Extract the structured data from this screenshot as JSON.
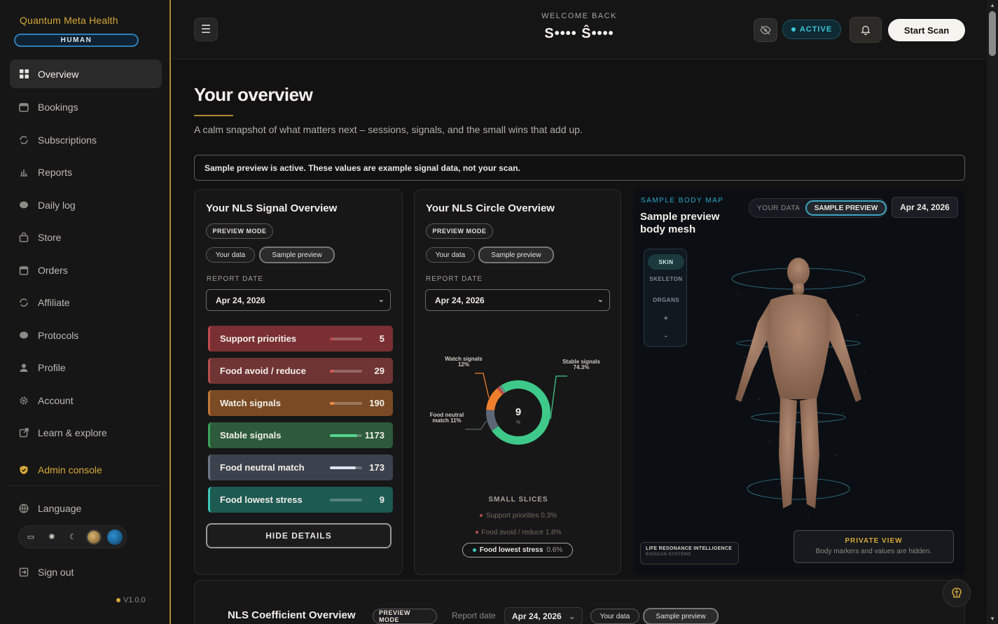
{
  "sidebar": {
    "brand": "Quantum Meta Health",
    "mode_badge": "HUMAN",
    "items": [
      {
        "label": "Overview",
        "icon": "grid-icon"
      },
      {
        "label": "Bookings",
        "icon": "calendar-icon"
      },
      {
        "label": "Subscriptions",
        "icon": "refresh-icon"
      },
      {
        "label": "Reports",
        "icon": "chart-icon"
      },
      {
        "label": "Daily log",
        "icon": "bubble-icon"
      },
      {
        "label": "Store",
        "icon": "bag-icon"
      },
      {
        "label": "Orders",
        "icon": "box-icon"
      },
      {
        "label": "Affiliate",
        "icon": "link-icon"
      },
      {
        "label": "Protocols",
        "icon": "bubble-icon"
      },
      {
        "label": "Profile",
        "icon": "person-icon"
      },
      {
        "label": "Account",
        "icon": "gear-icon"
      },
      {
        "label": "Learn & explore",
        "icon": "external-icon"
      }
    ],
    "admin": "Admin console",
    "language": "Language",
    "sign_out": "Sign out",
    "version": "V1.0.0"
  },
  "topbar": {
    "welcome": "WELCOME BACK",
    "user": "S•••• Ŝ••••",
    "status": "ACTIVE",
    "start_scan": "Start Scan"
  },
  "overview": {
    "title": "Your overview",
    "subtitle": "A calm snapshot of what matters next – sessions, signals, and the small wins that add up.",
    "notice": "Sample preview is active. These values are example signal data, not your scan."
  },
  "signal_card": {
    "title": "Your NLS Signal Overview",
    "mode": "PREVIEW MODE",
    "your_data": "Your data",
    "sample_preview": "Sample preview",
    "report_date_label": "REPORT DATE",
    "report_date": "Apr 24, 2026",
    "rows": [
      {
        "label": "Support priorities",
        "value": "5",
        "level": 0.02,
        "bg": "#7a2f33",
        "edge": "#c24a4f",
        "fill": "#c24a4f"
      },
      {
        "label": "Food avoid / reduce",
        "value": "29",
        "level": 0.08,
        "bg": "#6f3434",
        "edge": "#b8504d",
        "fill": "#e45a4f"
      },
      {
        "label": "Watch signals",
        "value": "190",
        "level": 0.12,
        "bg": "#7a4a25",
        "edge": "#c2793a",
        "fill": "#f08a3e"
      },
      {
        "label": "Stable signals",
        "value": "1173",
        "level": 0.85,
        "bg": "#2c5a3b",
        "edge": "#3ea15d",
        "fill": "#57d38c"
      },
      {
        "label": "Food neutral match",
        "value": "173",
        "level": 0.8,
        "bg": "#3c424d",
        "edge": "#6b7787",
        "fill": "#dfe6ef"
      },
      {
        "label": "Food lowest stress",
        "value": "9",
        "level": 0.0,
        "bg": "#1d5a52",
        "edge": "#3cc6b6",
        "fill": "#3cc6b6"
      }
    ],
    "hide_details": "HIDE DETAILS"
  },
  "circle_card": {
    "title": "Your NLS Circle Overview",
    "mode": "PREVIEW MODE",
    "your_data": "Your data",
    "sample_preview": "Sample preview",
    "report_date_label": "REPORT DATE",
    "report_date": "Apr 24, 2026",
    "small_slices_title": "SMALL SLICES",
    "small_slices": [
      {
        "label": "Support priorities",
        "pct": "0.3%",
        "color": "#b3484c"
      },
      {
        "label": "Food avoid / reduce",
        "pct": "1.8%",
        "color": "#b8504d"
      }
    ],
    "highlight_slice": {
      "label": "Food lowest stress",
      "pct": "0.6%"
    }
  },
  "chart_data": {
    "type": "pie",
    "center_value": "9",
    "center_unit": "%",
    "slices": [
      {
        "name": "Stable signals",
        "value": 74.3,
        "label": "Stable signals 74.3%",
        "color": "#3ec98a"
      },
      {
        "name": "Food neutral match",
        "value": 11,
        "label": "Food neutral match 11%",
        "color": "#5c6675"
      },
      {
        "name": "Watch signals",
        "value": 12,
        "label": "Watch signals 12%",
        "color": "#f07f2d"
      },
      {
        "name": "Food avoid / reduce",
        "value": 1.8,
        "color": "#b8504d"
      },
      {
        "name": "Food lowest stress",
        "value": 0.6,
        "color": "#3cc6b6"
      },
      {
        "name": "Support priorities",
        "value": 0.3,
        "color": "#b3484c"
      }
    ]
  },
  "bodymap": {
    "eyebrow": "SAMPLE BODY MAP",
    "title": "Sample preview body mesh",
    "your_data": "YOUR DATA",
    "sample_preview": "SAMPLE PREVIEW",
    "date": "Apr 24, 2026",
    "layers": [
      "SKIN",
      "SKELETON",
      "ORGANS",
      "+",
      "-"
    ],
    "lri_title": "LIFE RESONANCE INTELLIGENCE",
    "lri_sub": "BIOSCAN SYSTEMS",
    "private_title": "PRIVATE VIEW",
    "private_text": "Body markers and values are hidden."
  },
  "coefficient": {
    "title": "NLS Coefficient Overview",
    "mode": "PREVIEW MODE",
    "report_date_label": "Report date",
    "report_date": "Apr 24, 2026",
    "your_data": "Your data",
    "sample_preview": "Sample preview"
  }
}
